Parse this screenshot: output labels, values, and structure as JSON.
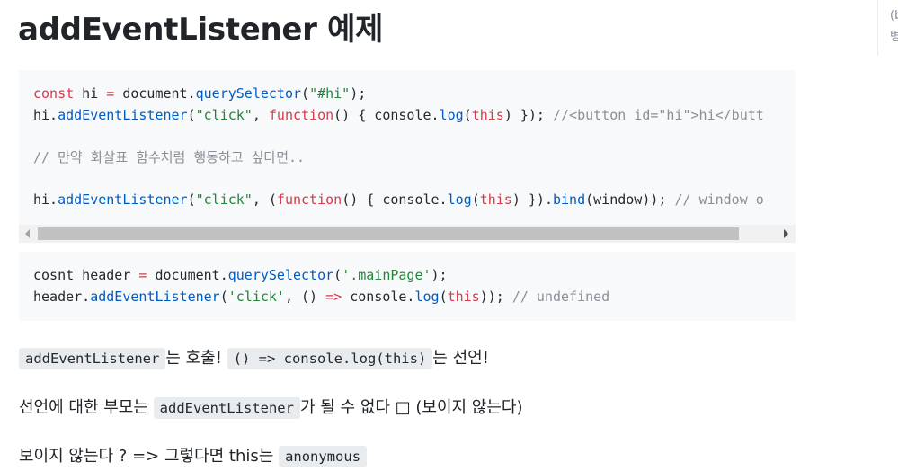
{
  "page": {
    "title": "addEventListener 예제",
    "side_text": "(b\n병"
  },
  "code_block_1": {
    "lines": [
      {
        "tokens": [
          {
            "t": "const",
            "c": "kw"
          },
          {
            "t": " hi ",
            "c": ""
          },
          {
            "t": "=",
            "c": "op"
          },
          {
            "t": " document.",
            "c": ""
          },
          {
            "t": "querySelector",
            "c": "pr"
          },
          {
            "t": "(",
            "c": ""
          },
          {
            "t": "\"#hi\"",
            "c": "str"
          },
          {
            "t": ");",
            "c": ""
          }
        ]
      },
      {
        "tokens": [
          {
            "t": "hi.",
            "c": ""
          },
          {
            "t": "addEventListener",
            "c": "pr"
          },
          {
            "t": "(",
            "c": ""
          },
          {
            "t": "\"click\"",
            "c": "str"
          },
          {
            "t": ", ",
            "c": ""
          },
          {
            "t": "function",
            "c": "kw"
          },
          {
            "t": "() { console.",
            "c": ""
          },
          {
            "t": "log",
            "c": "pr"
          },
          {
            "t": "(",
            "c": ""
          },
          {
            "t": "this",
            "c": "kw"
          },
          {
            "t": ") }); ",
            "c": ""
          },
          {
            "t": "//<button id=\"hi\">hi</butt",
            "c": "cm"
          }
        ]
      },
      {
        "tokens": []
      },
      {
        "tokens": [
          {
            "t": "// 만약 화살표 함수처럼 행동하고 싶다면..",
            "c": "cm"
          }
        ]
      },
      {
        "tokens": []
      },
      {
        "tokens": [
          {
            "t": "hi.",
            "c": ""
          },
          {
            "t": "addEventListener",
            "c": "pr"
          },
          {
            "t": "(",
            "c": ""
          },
          {
            "t": "\"click\"",
            "c": "str"
          },
          {
            "t": ", (",
            "c": ""
          },
          {
            "t": "function",
            "c": "kw"
          },
          {
            "t": "() { console.",
            "c": ""
          },
          {
            "t": "log",
            "c": "pr"
          },
          {
            "t": "(",
            "c": ""
          },
          {
            "t": "this",
            "c": "kw"
          },
          {
            "t": ") }).",
            "c": ""
          },
          {
            "t": "bind",
            "c": "pr"
          },
          {
            "t": "(window)); ",
            "c": ""
          },
          {
            "t": "// window o",
            "c": "cm"
          }
        ]
      }
    ]
  },
  "code_block_2": {
    "lines": [
      {
        "tokens": [
          {
            "t": "cosnt header ",
            "c": ""
          },
          {
            "t": "=",
            "c": "op"
          },
          {
            "t": " document.",
            "c": ""
          },
          {
            "t": "querySelector",
            "c": "pr"
          },
          {
            "t": "(",
            "c": ""
          },
          {
            "t": "'.mainPage'",
            "c": "str"
          },
          {
            "t": ");",
            "c": ""
          }
        ]
      },
      {
        "tokens": [
          {
            "t": "header.",
            "c": ""
          },
          {
            "t": "addEventListener",
            "c": "pr"
          },
          {
            "t": "(",
            "c": ""
          },
          {
            "t": "'click'",
            "c": "str"
          },
          {
            "t": ", () ",
            "c": ""
          },
          {
            "t": "=>",
            "c": "op"
          },
          {
            "t": " console.",
            "c": ""
          },
          {
            "t": "log",
            "c": "pr"
          },
          {
            "t": "(",
            "c": ""
          },
          {
            "t": "this",
            "c": "kw"
          },
          {
            "t": ")); ",
            "c": ""
          },
          {
            "t": "// undefined",
            "c": "cm"
          }
        ]
      }
    ]
  },
  "paragraphs": {
    "p1": {
      "code1": "addEventListener",
      "text1": "는 호출! ",
      "code2": "() => console.log(this)",
      "text2": "는 선언!"
    },
    "p2": {
      "text1": "선언에 대한 부모는 ",
      "code1": "addEventListener",
      "text2": "가 될 수 없다 □ (보이지 않는다)"
    },
    "p3": {
      "text1": "보이지 않는다 ? => 그렇다면 this는 ",
      "code1": "anonymous"
    }
  },
  "scrollbar": {
    "position_fraction": 0.0
  }
}
